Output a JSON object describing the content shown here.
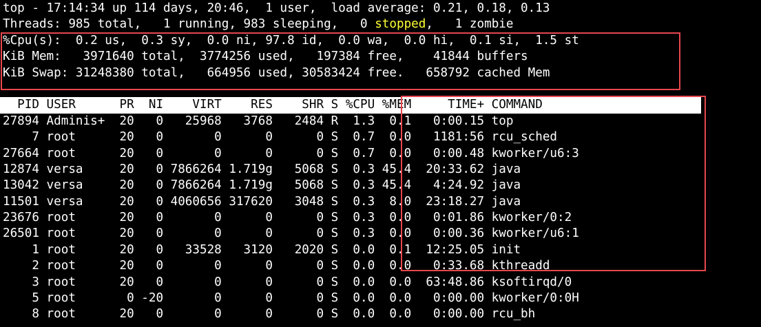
{
  "summary": {
    "top_line": "top - 17:14:34 up 114 days, 20:46,  1 user,  load average: 0.21, 0.18, 0.13",
    "threads_prefix": "Threads: 985 total,   1 running, 983 sleeping,   0 ",
    "threads_stopped": "stopped",
    "threads_suffix": ",   1 zombie",
    "cpu_line": "%Cpu(s):  0.2 us,  0.3 sy,  0.0 ni, 97.8 id,  0.0 wa,  0.0 hi,  0.1 si,  1.5 st",
    "mem_line": "KiB Mem:   3971640 total,  3774256 used,   197384 free,    41844 buffers",
    "swap_line": "KiB Swap: 31248380 total,   664956 used, 30583424 free.   658792 cached Mem"
  },
  "table": {
    "header": "  PID USER      PR  NI    VIRT    RES    SHR S %CPU %MEM     TIME+ COMMAND",
    "rows": [
      "27894 Adminis+  20   0   25968   3768   2484 R  1.3  0.1   0:00.15 top",
      "    7 root      20   0       0      0      0 S  0.7  0.0   1181:56 rcu_sched",
      "27664 root      20   0       0      0      0 S  0.7  0.0   0:00.48 kworker/u6:3",
      "12874 versa     20   0 7866264 1.719g   5068 S  0.3 45.4  20:33.62 java",
      "13042 versa     20   0 7866264 1.719g   5068 S  0.3 45.4   4:24.92 java",
      "11501 versa     20   0 4060656 317620   3048 S  0.3  8.0  23:18.27 java",
      "23676 root      20   0       0      0      0 S  0.3  0.0   0:01.86 kworker/0:2",
      "26501 root      20   0       0      0      0 S  0.3  0.0   0:00.36 kworker/u6:1",
      "    1 root      20   0   33528   3120   2020 S  0.0  0.1  12:25.05 init",
      "    2 root      20   0       0      0      0 S  0.0  0.0   0:33.68 kthreadd",
      "    3 root      20   0       0      0      0 S  0.0  0.0  63:48.86 ksoftirqd/0",
      "    5 root       0 -20       0      0      0 S  0.0  0.0   0:00.00 kworker/0:0H",
      "    8 root      20   0       0      0      0 S  0.0  0.0   0:00.00 rcu_bh"
    ]
  },
  "colors": {
    "background": "#000000",
    "text": "#ffffff",
    "stopped": "#ffff33",
    "highlight_box": "#e8474f"
  }
}
